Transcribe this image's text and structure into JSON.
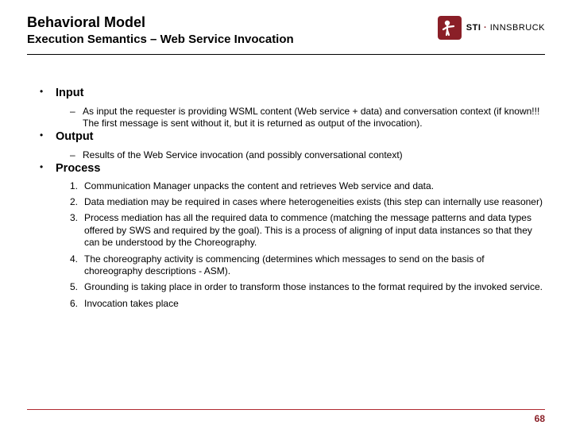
{
  "header": {
    "title": "Behavioral Model",
    "subtitle": "Execution Semantics – Web Service Invocation"
  },
  "logo": {
    "org": "STI",
    "sep": "·",
    "place": "INNSBRUCK"
  },
  "sections": [
    {
      "heading": "Input",
      "dashes": [
        "As input the requester is providing WSML content (Web service + data) and conversation context (if known!!! The first message is sent without it, but it is returned as output of the invocation)."
      ]
    },
    {
      "heading": "Output",
      "dashes": [
        "Results of the Web Service invocation (and possibly conversational context)"
      ]
    },
    {
      "heading": "Process",
      "numbered": [
        "Communication Manager unpacks the content and retrieves Web service and data.",
        "Data mediation may be required in cases where heterogeneities exists (this step can internally use reasoner)",
        "Process mediation has all the required data to commence (matching the message patterns and data types offered by SWS and required by the goal). This is a process of aligning of input data instances so that they can be understood by the Choreography.",
        "The choreography activity is commencing (determines which messages to send on the basis of choreography descriptions - ASM).",
        "Grounding is taking place in order to transform those instances to the format required by the invoked service.",
        "Invocation takes place"
      ]
    }
  ],
  "page_number": "68"
}
